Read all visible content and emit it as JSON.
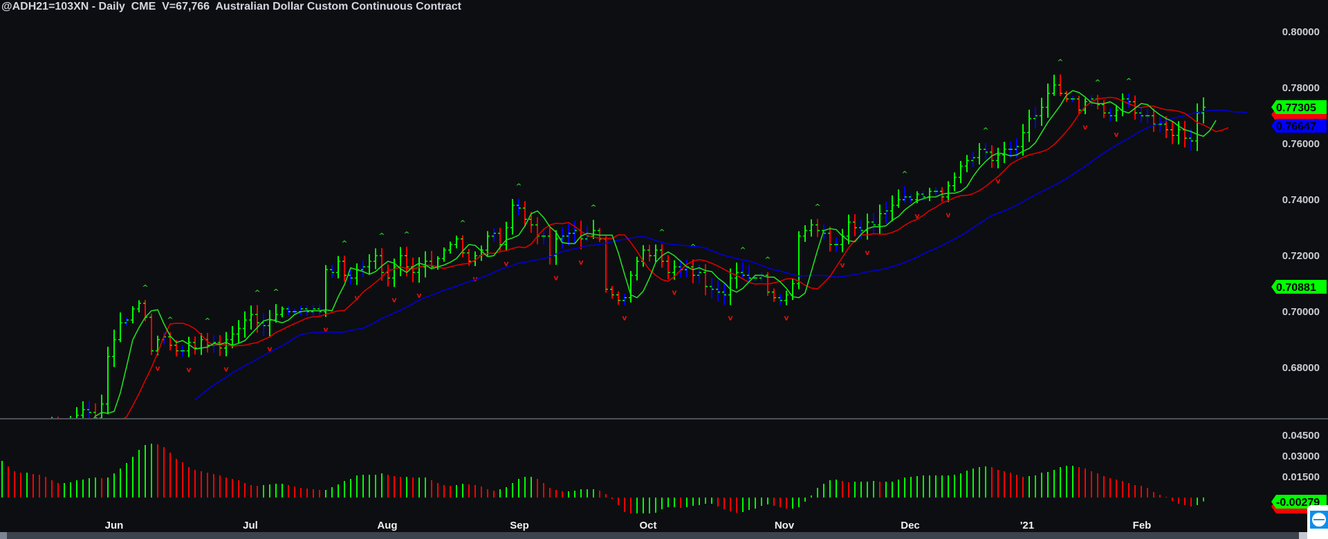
{
  "header": {
    "title": "@ADH21=103XN - Daily  CME  V=67,766  Australian Dollar Custom Continuous Contract"
  },
  "colors": {
    "background": "#0d0e11",
    "up": "#00ff00",
    "down": "#ff0000",
    "neutral": "#0000ff",
    "ma_fast": "#22dd22",
    "ma_mid": "#dd0000",
    "ma_slow": "#0000dd",
    "divider": "#8a94a6"
  },
  "price_tags": [
    {
      "value": "0.77305",
      "color": "#00ff00"
    },
    {
      "value": "",
      "color": "#ff0000"
    },
    {
      "value": "0.76647",
      "color": "#0000ff"
    },
    {
      "value": "0.70881",
      "color": "#00ff00"
    }
  ],
  "osc_tags": [
    {
      "value": "",
      "color": "#ff0000"
    },
    {
      "value": "-0.00279",
      "color": "#00ff00"
    }
  ],
  "chart_data": [
    {
      "type": "ohlc",
      "title": "@ADH21=103XN - Daily",
      "y_ticks": [
        "0.80000",
        "0.78000",
        "0.76000",
        "0.74000",
        "0.72000",
        "0.70000",
        "0.68000"
      ],
      "ylim": [
        0.657,
        0.804
      ],
      "x_ticks": [
        "Jun",
        "Jul",
        "Aug",
        "Sep",
        "Oct",
        "Nov",
        "Dec",
        "'21",
        "Feb"
      ],
      "overlays": [
        "fast displaced MA (green)",
        "medium displaced MA (red)",
        "slow displaced MA (blue)"
      ],
      "closes": [
        0.643,
        0.645,
        0.648,
        0.65,
        0.652,
        0.65,
        0.655,
        0.658,
        0.66,
        0.658,
        0.656,
        0.66,
        0.663,
        0.665,
        0.664,
        0.662,
        0.667,
        0.684,
        0.69,
        0.696,
        0.697,
        0.701,
        0.703,
        0.698,
        0.686,
        0.69,
        0.691,
        0.688,
        0.686,
        0.686,
        0.689,
        0.687,
        0.69,
        0.688,
        0.689,
        0.687,
        0.69,
        0.692,
        0.694,
        0.697,
        0.699,
        0.696,
        0.695,
        0.697,
        0.699,
        0.701,
        0.7,
        0.7,
        0.701,
        0.7,
        0.701,
        0.7,
        0.715,
        0.714,
        0.718,
        0.713,
        0.712,
        0.715,
        0.716,
        0.718,
        0.72,
        0.714,
        0.712,
        0.716,
        0.72,
        0.716,
        0.714,
        0.716,
        0.718,
        0.716,
        0.719,
        0.722,
        0.724,
        0.726,
        0.721,
        0.718,
        0.72,
        0.722,
        0.727,
        0.728,
        0.724,
        0.73,
        0.738,
        0.737,
        0.733,
        0.731,
        0.727,
        0.727,
        0.72,
        0.726,
        0.727,
        0.728,
        0.729,
        0.726,
        0.727,
        0.729,
        0.726,
        0.708,
        0.706,
        0.704,
        0.705,
        0.713,
        0.718,
        0.722,
        0.72,
        0.722,
        0.718,
        0.714,
        0.716,
        0.715,
        0.716,
        0.713,
        0.714,
        0.709,
        0.708,
        0.707,
        0.706,
        0.712,
        0.714,
        0.713,
        0.712,
        0.712,
        0.713,
        0.707,
        0.705,
        0.704,
        0.706,
        0.71,
        0.727,
        0.729,
        0.731,
        0.729,
        0.728,
        0.724,
        0.724,
        0.727,
        0.732,
        0.73,
        0.729,
        0.732,
        0.731,
        0.735,
        0.736,
        0.738,
        0.74,
        0.741,
        0.74,
        0.742,
        0.741,
        0.743,
        0.743,
        0.741,
        0.745,
        0.748,
        0.752,
        0.754,
        0.755,
        0.758,
        0.757,
        0.754,
        0.756,
        0.758,
        0.758,
        0.759,
        0.764,
        0.769,
        0.77,
        0.773,
        0.778,
        0.781,
        0.778,
        0.776,
        0.776,
        0.772,
        0.775,
        0.776,
        0.774,
        0.771,
        0.77,
        0.772,
        0.776,
        0.775,
        0.771,
        0.77,
        0.77,
        0.767,
        0.767,
        0.765,
        0.763,
        0.765,
        0.762,
        0.761,
        0.771,
        0.77305
      ]
    },
    {
      "type": "bar",
      "y_ticks": [
        "0.04500",
        "0.03000",
        "0.01500"
      ],
      "ylim": [
        -0.012,
        0.048
      ],
      "values": [
        0.0265,
        0.0225,
        0.019,
        0.018,
        0.018,
        0.017,
        0.0165,
        0.015,
        0.0125,
        0.0105,
        0.0105,
        0.011,
        0.0125,
        0.013,
        0.014,
        0.0145,
        0.014,
        0.0145,
        0.0175,
        0.021,
        0.025,
        0.0295,
        0.0345,
        0.038,
        0.039,
        0.0385,
        0.0365,
        0.0325,
        0.028,
        0.0255,
        0.022,
        0.02,
        0.019,
        0.018,
        0.017,
        0.016,
        0.0145,
        0.0135,
        0.0125,
        0.0105,
        0.009,
        0.0085,
        0.009,
        0.0095,
        0.01,
        0.01,
        0.009,
        0.008,
        0.007,
        0.0065,
        0.006,
        0.0055,
        0.0055,
        0.0075,
        0.0095,
        0.012,
        0.0135,
        0.016,
        0.0165,
        0.0165,
        0.0165,
        0.0175,
        0.0165,
        0.0155,
        0.015,
        0.015,
        0.0145,
        0.0145,
        0.0145,
        0.0125,
        0.0105,
        0.009,
        0.0085,
        0.009,
        0.01,
        0.0095,
        0.009,
        0.008,
        0.006,
        0.005,
        0.006,
        0.0075,
        0.0105,
        0.0135,
        0.015,
        0.015,
        0.0135,
        0.0105,
        0.007,
        0.0055,
        0.0045,
        0.0045,
        0.005,
        0.006,
        0.006,
        0.006,
        0.005,
        0.0025,
        -0.001,
        -0.0055,
        -0.0105,
        -0.0115,
        -0.0115,
        -0.0115,
        -0.0115,
        -0.011,
        -0.0085,
        -0.007,
        -0.007,
        -0.0075,
        -0.007,
        -0.006,
        -0.0055,
        -0.0045,
        -0.0045,
        -0.0065,
        -0.0085,
        -0.01,
        -0.011,
        -0.0105,
        -0.009,
        -0.008,
        -0.006,
        -0.005,
        -0.006,
        -0.007,
        -0.008,
        -0.008,
        -0.007,
        -0.003,
        0.0015,
        0.007,
        0.01,
        0.0125,
        0.013,
        0.012,
        0.011,
        0.0115,
        0.0115,
        0.0115,
        0.012,
        0.0115,
        0.0115,
        0.0115,
        0.013,
        0.0145,
        0.015,
        0.0155,
        0.016,
        0.016,
        0.016,
        0.016,
        0.016,
        0.0165,
        0.0175,
        0.0195,
        0.021,
        0.022,
        0.0225,
        0.022,
        0.02,
        0.019,
        0.018,
        0.0165,
        0.015,
        0.0155,
        0.016,
        0.018,
        0.0185,
        0.02,
        0.022,
        0.023,
        0.023,
        0.022,
        0.021,
        0.019,
        0.0175,
        0.0155,
        0.014,
        0.013,
        0.012,
        0.0105,
        0.009,
        0.0085,
        0.007,
        0.004,
        0.002,
        0.0005,
        -0.0025,
        -0.0045,
        -0.0055,
        -0.0065,
        -0.0055,
        -0.00279
      ]
    }
  ]
}
